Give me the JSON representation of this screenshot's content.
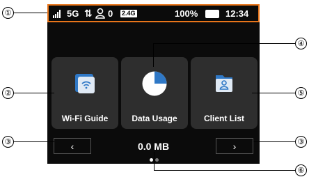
{
  "colors": {
    "accent": "#e8751a",
    "screen_bg": "#0b0b0b",
    "tile_bg": "#2e2e2e",
    "active_dot": "#ffffff",
    "inactive_dot": "#7a7a7a"
  },
  "status_bar": {
    "network": "5G",
    "client_count": "0",
    "band": "2.4G",
    "battery_percent": "100%",
    "time": "12:34",
    "icons": [
      "signal-icon",
      "data-arrows-icon",
      "person-icon",
      "battery-icon"
    ]
  },
  "tiles": [
    {
      "label": "Wi-Fi Guide",
      "icon": "wifi-guide-icon"
    },
    {
      "label": "Data Usage",
      "icon": "pie-chart-icon"
    },
    {
      "label": "Client List",
      "icon": "client-list-icon"
    }
  ],
  "navigation": {
    "prev": "‹",
    "next": "›"
  },
  "data_usage_value": "0.0 MB",
  "pagination": {
    "pages": 2,
    "current": 1
  },
  "callouts": [
    "①",
    "②",
    "③",
    "④",
    "⑤",
    "③",
    "⑥"
  ]
}
